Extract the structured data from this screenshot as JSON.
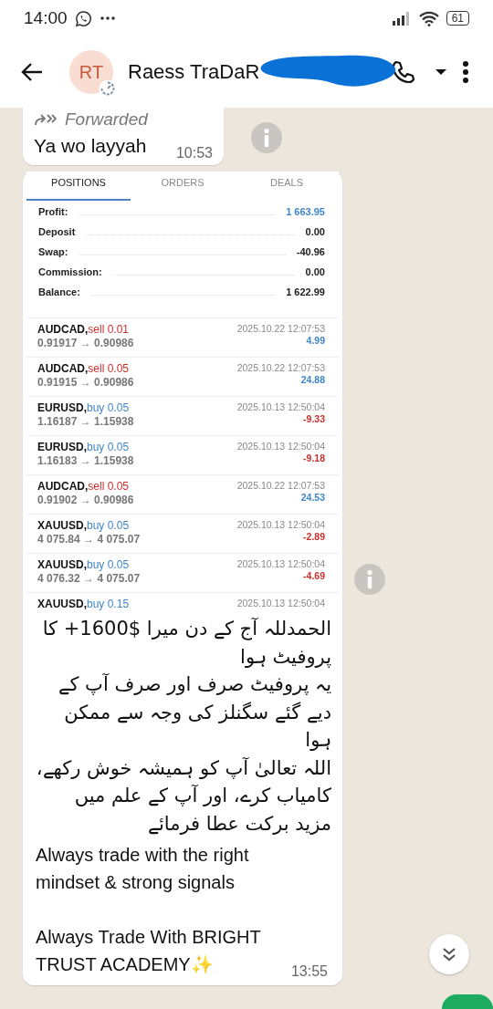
{
  "status_bar": {
    "time": "14:00",
    "battery": "61"
  },
  "header": {
    "avatar_initials": "RT",
    "contact_name": "Raess TraDaR"
  },
  "forwarded_message": {
    "forwarded_label": "Forwarded",
    "text": "Ya wo layyah",
    "time": "10:53"
  },
  "image_message": {
    "trade_screenshot": {
      "tabs": [
        {
          "label": "POSITIONS",
          "selected": true
        },
        {
          "label": "ORDERS",
          "selected": false
        },
        {
          "label": "DEALS",
          "selected": false
        }
      ],
      "summary": [
        {
          "label": "Profit:",
          "value": "1 663.95",
          "highlight": true
        },
        {
          "label": "Deposit",
          "value": "0.00",
          "highlight": false
        },
        {
          "label": "Swap:",
          "value": "-40.96",
          "highlight": false
        },
        {
          "label": "Commission:",
          "value": "0.00",
          "highlight": false
        },
        {
          "label": "Balance:",
          "value": "1 622.99",
          "highlight": false
        }
      ],
      "positions": [
        {
          "symbol": "AUDCAD,",
          "kind": "sell",
          "order": "sell 0.01",
          "prices": "0.91917 → 0.90986",
          "time": "2025.10.22 12:07:53",
          "profit": "4.99",
          "profit_positive": true
        },
        {
          "symbol": "AUDCAD,",
          "kind": "sell",
          "order": "sell 0.05",
          "prices": "0.91915 → 0.90986",
          "time": "2025.10.22 12:07:53",
          "profit": "24.88",
          "profit_positive": true
        },
        {
          "symbol": "EURUSD,",
          "kind": "buy",
          "order": "buy 0.05",
          "prices": "1.16187 → 1.15938",
          "time": "2025.10.13 12:50:04",
          "profit": "-9.33",
          "profit_positive": false
        },
        {
          "symbol": "EURUSD,",
          "kind": "buy",
          "order": "buy 0.05",
          "prices": "1.16183 → 1.15938",
          "time": "2025.10.13 12:50:04",
          "profit": "-9.18",
          "profit_positive": false
        },
        {
          "symbol": "AUDCAD,",
          "kind": "sell",
          "order": "sell 0.05",
          "prices": "0.91902 → 0.90986",
          "time": "2025.10.22 12:07:53",
          "profit": "24.53",
          "profit_positive": true
        },
        {
          "symbol": "XAUUSD,",
          "kind": "buy",
          "order": "buy 0.05",
          "prices": "4 075.84 → 4 075.07",
          "time": "2025.10.13 12:50:04",
          "profit": "-2.89",
          "profit_positive": false
        },
        {
          "symbol": "XAUUSD,",
          "kind": "buy",
          "order": "buy 0.05",
          "prices": "4 076.32 → 4 075.07",
          "time": "2025.10.13 12:50:04",
          "profit": "-4.69",
          "profit_positive": false
        },
        {
          "symbol": "XAUUSD,",
          "kind": "buy",
          "order": "buy 0.15",
          "time": "2025.10.13 12:50:04"
        }
      ]
    },
    "urdu_paragraphs": [
      "الحمدللہ آج کے دن میرا $1600+ کا پروفیٹ ہوا",
      "یہ پروفیٹ صرف اور صرف آپ کے دیے گئے سگنلز کی وجہ سے ممکن ہوا",
      "اللہ تعالیٰ آپ کو ہمیشہ خوش رکھے، کامیاب کرے، اور آپ کے علم میں مزید برکت عطا فرمائے"
    ],
    "english_paragraphs": [
      "Always trade with the right mindset & strong signals",
      "Always Trade With BRIGHT TRUST ACADEMY✨"
    ],
    "time": "13:55"
  }
}
